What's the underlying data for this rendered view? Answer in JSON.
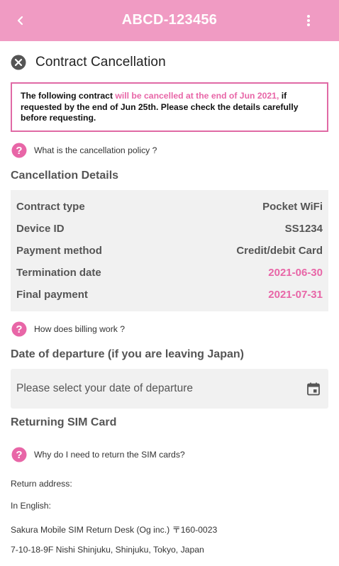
{
  "header": {
    "title": "ABCD-123456",
    "back_icon": "chevron-left-icon",
    "menu_icon": "more-vertical-icon"
  },
  "page": {
    "title": "Contract Cancellation",
    "title_icon": "close-circle-icon"
  },
  "notice": {
    "part1": "The following contract ",
    "highlight": "will be cancelled at the end of Jun 2021,",
    "part2": " if requested by the end of Jun 25th. Please check the details carefully before requesting."
  },
  "help_links": {
    "policy": "What is the cancellation policy ?",
    "billing": "How does billing work ?",
    "sim": "Why do I need to return the SIM cards?"
  },
  "cancellation_details": {
    "title": "Cancellation Details",
    "rows": [
      {
        "label": "Contract type",
        "value": "Pocket WiFi"
      },
      {
        "label": "Device ID",
        "value": "SS1234"
      },
      {
        "label": "Payment method",
        "value": "Credit/debit Card"
      },
      {
        "label": "Termination date",
        "value": "2021-06-30"
      },
      {
        "label": "Final payment",
        "value": "2021-07-31"
      }
    ]
  },
  "departure": {
    "title": "Date of departure (if you are leaving Japan)",
    "placeholder": "Please select your date of departure"
  },
  "returning": {
    "title": "Returning SIM Card",
    "lines": [
      "Return address:",
      "In English:",
      "Sakura Mobile SIM Return Desk (Og inc.) 〒160-0023",
      "7-10-18-9F Nishi Shinjuku, Shinjuku, Tokyo, Japan"
    ]
  },
  "colors": {
    "header_bg": "#f09bc3",
    "accent_pink": "#e866a7",
    "border_pink": "#e06aa5",
    "panel_bg": "#f1f1f1"
  }
}
